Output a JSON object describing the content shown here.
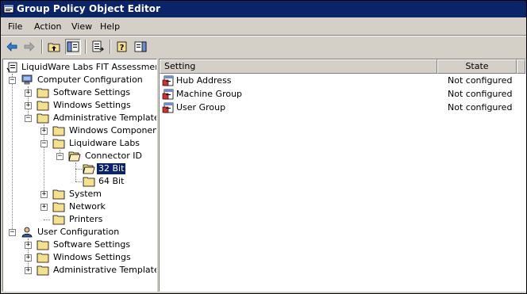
{
  "window": {
    "title": "Group Policy Object Editor"
  },
  "menu": [
    "File",
    "Action",
    "View",
    "Help"
  ],
  "tree": {
    "root": "LiquidWare Labs FIT Assessment [I",
    "computer_config": "Computer Configuration",
    "cc_software": "Software Settings",
    "cc_windows": "Windows Settings",
    "cc_admin": "Administrative Templates",
    "windows_components": "Windows Components",
    "liquidware": "Liquidware Labs",
    "connector": "Connector ID",
    "bit32": "32 Bit",
    "bit64": "64 Bit",
    "system": "System",
    "network": "Network",
    "printers": "Printers",
    "user_config": "User Configuration",
    "uc_software": "Software Settings",
    "uc_windows": "Windows Settings",
    "uc_admin": "Administrative Templates"
  },
  "list": {
    "headers": {
      "setting": "Setting",
      "state": "State"
    },
    "rows": [
      {
        "setting": "Hub Address",
        "state": "Not configured"
      },
      {
        "setting": "Machine Group",
        "state": "Not configured"
      },
      {
        "setting": "User Group",
        "state": "Not configured"
      }
    ]
  },
  "colors": {
    "titlebar": "#0a246a",
    "folder": "#f7e08a",
    "face": "#d4d0c8"
  }
}
